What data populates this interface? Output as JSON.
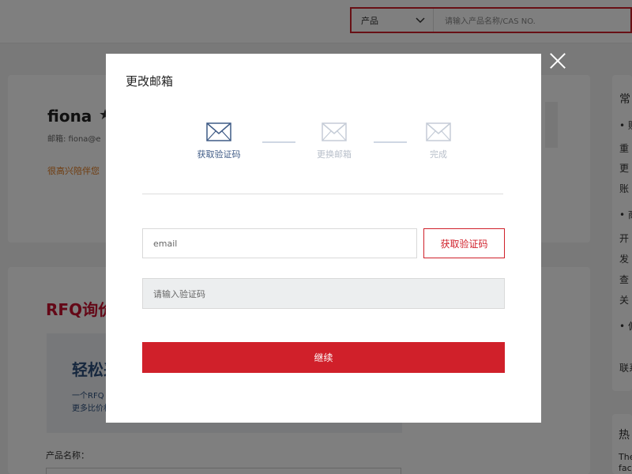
{
  "search": {
    "category": "产品",
    "placeholder": "请输入产品名称/CAS NO."
  },
  "profile": {
    "name": "fiona",
    "email_label": "邮箱: fiona@e",
    "welcome": "很高兴陪伴您"
  },
  "rfq": {
    "title": "RFQ询价",
    "headline": "轻松采",
    "line1": "一个RFQ",
    "line2": "更多比价机",
    "product_label": "产品名称："
  },
  "sidebar": {
    "heading": "常",
    "items": [
      "• 账",
      "重",
      "更",
      "账",
      "• 商",
      "开",
      "发",
      "查",
      "关",
      "• 偏",
      "联系"
    ],
    "hot_heading": "热",
    "hot_line1": "The",
    "hot_line2": "fac"
  },
  "modal": {
    "title": "更改邮箱",
    "steps": [
      {
        "label": "获取验证码"
      },
      {
        "label": "更换邮箱"
      },
      {
        "label": "完成"
      }
    ],
    "email_placeholder": "email",
    "get_code_label": "获取验证码",
    "code_placeholder": "请输入验证码",
    "continue_label": "继续"
  },
  "colors": {
    "brand_red": "#d0202a",
    "step_active": "#3f5b86",
    "step_inactive": "#b8bfca"
  }
}
